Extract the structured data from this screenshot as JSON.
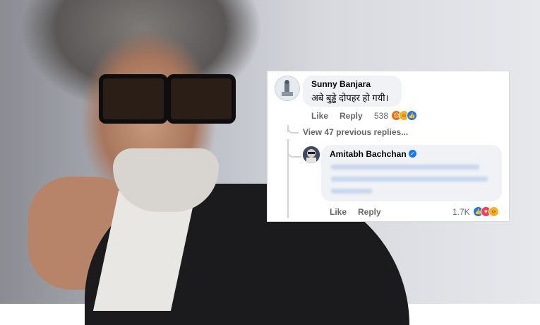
{
  "comment1": {
    "author": "Sunny Banjara",
    "text": "अबे बुड्ढे  दोपहर हो गयी।",
    "like_label": "Like",
    "reply_label": "Reply",
    "reaction_count": "538",
    "reactions": [
      "angry",
      "haha",
      "like"
    ]
  },
  "thread": {
    "view_previous": "View 47 previous replies..."
  },
  "comment2": {
    "author": "Amitabh Bachchan",
    "verified": true,
    "text_blurred": true,
    "like_label": "Like",
    "reply_label": "Reply",
    "reaction_count": "1.7K",
    "reactions": [
      "like",
      "love",
      "haha"
    ]
  },
  "colors": {
    "facebook_blue": "#1877f2",
    "bubble_bg": "#f0f2f5",
    "muted_text": "#65676b"
  }
}
